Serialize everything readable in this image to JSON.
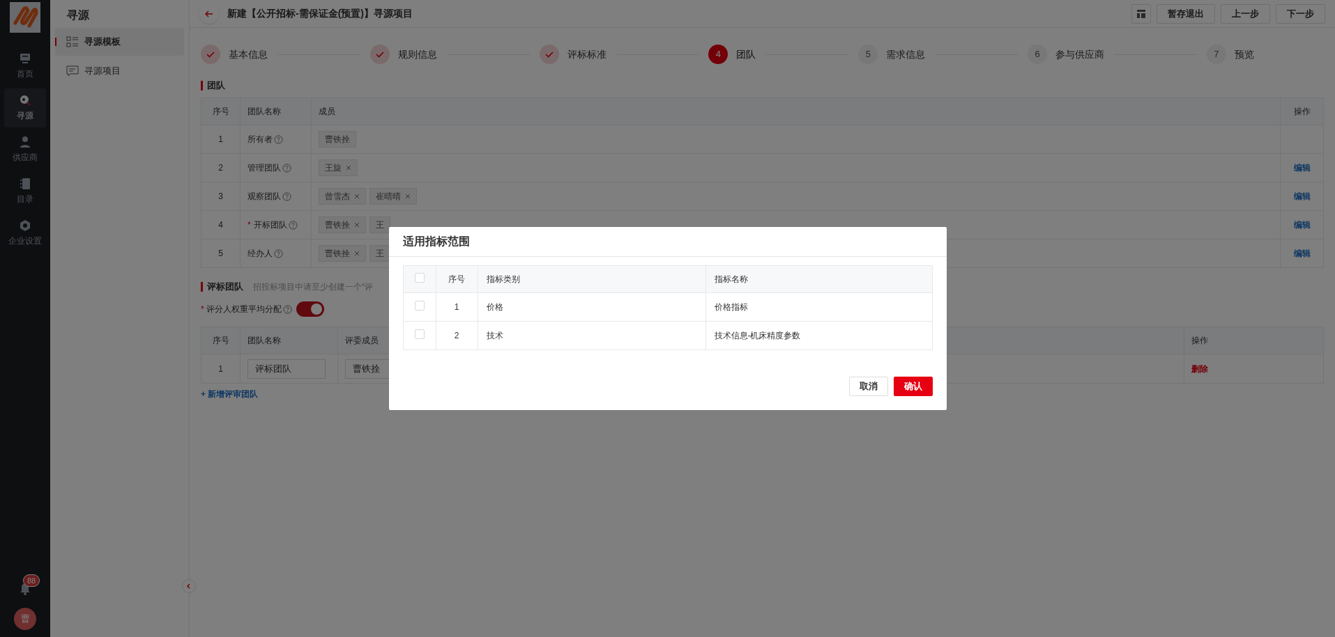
{
  "rail": {
    "items": [
      {
        "label": "首页",
        "selected": false
      },
      {
        "label": "寻源",
        "selected": true
      },
      {
        "label": "供应商",
        "selected": false
      },
      {
        "label": "目录",
        "selected": false
      },
      {
        "label": "企业设置",
        "selected": false
      }
    ],
    "badge": "88",
    "avatar": "曹"
  },
  "sidebar": {
    "title": "寻源",
    "items": [
      {
        "label": "寻源模板",
        "selected": true
      },
      {
        "label": "寻源项目",
        "selected": false
      }
    ]
  },
  "header": {
    "title": "新建【公开招标-需保证金(预置)】寻源项目",
    "buttons": [
      "暂存退出",
      "上一步",
      "下一步"
    ]
  },
  "steps": [
    {
      "label": "基本信息",
      "done": true,
      "selected": false
    },
    {
      "label": "规则信息",
      "done": true,
      "selected": false
    },
    {
      "label": "评标标准",
      "done": true,
      "selected": false
    },
    {
      "number": "4",
      "label": "团队",
      "done": false,
      "selected": true
    },
    {
      "number": "5",
      "label": "需求信息",
      "done": false,
      "selected": false
    },
    {
      "number": "6",
      "label": "参与供应商",
      "done": false,
      "selected": false
    },
    {
      "number": "7",
      "label": "预览",
      "done": false,
      "selected": false
    }
  ],
  "team": {
    "title": "团队",
    "columns": [
      "序号",
      "团队名称",
      "成员",
      "操作"
    ],
    "rows": [
      {
        "index": "1",
        "name": "所有者",
        "members": [
          {
            "name": "曹铁拴",
            "removable": false
          }
        ]
      },
      {
        "index": "2",
        "name": "管理团队",
        "members": [
          {
            "name": "王旋",
            "removable": true
          }
        ],
        "action": "编辑"
      },
      {
        "index": "3",
        "name": "观察团队",
        "members": [
          {
            "name": "曾雪杰",
            "removable": true
          },
          {
            "name": "崔晴晴",
            "removable": true
          }
        ],
        "action": "编辑"
      },
      {
        "index": "4",
        "name": "开标团队",
        "required_mark": "*",
        "members": [
          {
            "name": "曹铁拴",
            "removable": true
          },
          {
            "name": "王",
            "removable": false
          }
        ],
        "action": "编辑"
      },
      {
        "index": "5",
        "name": "经办人",
        "members": [
          {
            "name": "曹铁拴",
            "removable": true
          },
          {
            "name": "王",
            "removable": false
          }
        ],
        "action": "编辑"
      }
    ]
  },
  "eval": {
    "title": "评标团队",
    "hint": "招投标项目中请至少创建一个“评",
    "switch": {
      "label": "评分人权重平均分配",
      "required_mark": "*",
      "on": true
    },
    "columns": [
      "序号",
      "团队名称",
      "评委成员",
      "操作"
    ],
    "rows": [
      {
        "index": "1",
        "name": "评标团队",
        "member": "曹铁拴",
        "action": "删除"
      }
    ],
    "add": "+ 新增评审团队"
  },
  "modal": {
    "title": "适用指标范围",
    "all_checked": false,
    "columns": [
      "序号",
      "指标类别",
      "指标名称"
    ],
    "rows": [
      {
        "checked": false,
        "index": "1",
        "category": "价格",
        "name": "价格指标"
      },
      {
        "checked": false,
        "index": "2",
        "category": "技术",
        "name": "技术信息-机床精度参数"
      }
    ],
    "buttons": [
      {
        "label": "取消",
        "kind": "secondary"
      },
      {
        "label": "确认",
        "kind": "primary"
      }
    ]
  }
}
